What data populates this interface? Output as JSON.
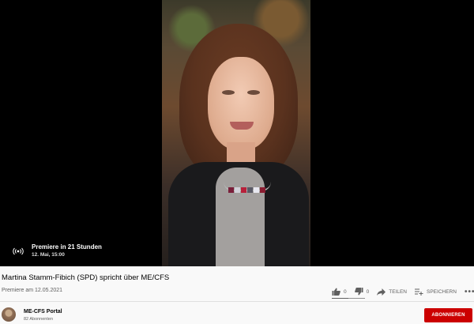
{
  "player": {
    "premiere_label": "Premiere in 21 Stunden",
    "premiere_date": "12. Mai, 15:00",
    "premiere_icon": "live-broadcast-icon"
  },
  "video": {
    "title": "Martina Stamm-Fibich (SPD) spricht über ME/CFS",
    "date": "Premiere am 12.05.2021"
  },
  "actions": {
    "likes": "0",
    "dislikes": "0",
    "share_label": "TEILEN",
    "save_label": "SPEICHERN",
    "more_label": "•••",
    "like_ratio": 0.5
  },
  "channel": {
    "name": "ME-CFS Portal",
    "subscribers": "82 Abonnenten",
    "subscribe_label": "ABONNIEREN"
  },
  "colors": {
    "brand_red": "#cc0000",
    "text_secondary": "#606060"
  }
}
